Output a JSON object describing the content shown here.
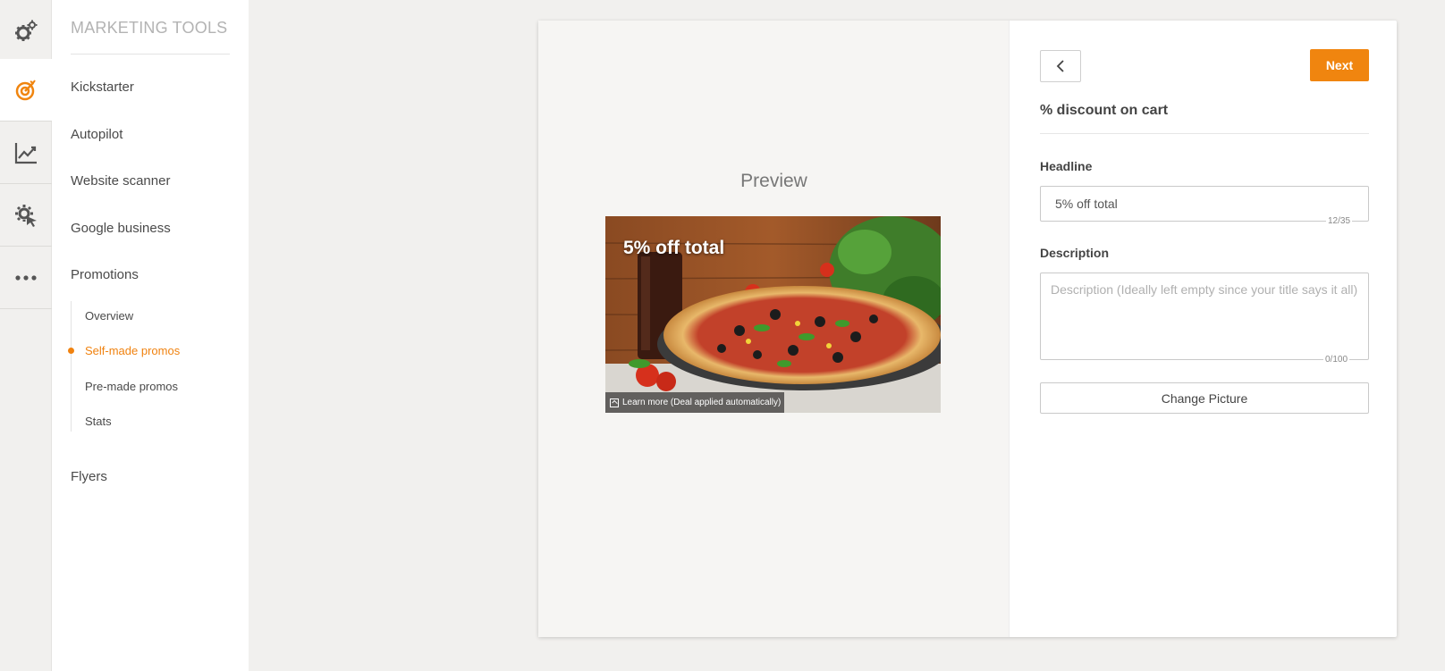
{
  "sidebar": {
    "title": "MARKETING TOOLS",
    "items": [
      {
        "label": "Kickstarter"
      },
      {
        "label": "Autopilot"
      },
      {
        "label": "Website scanner"
      },
      {
        "label": "Google business"
      },
      {
        "label": "Promotions"
      },
      {
        "label": "Flyers"
      }
    ],
    "promotions_sub": [
      {
        "label": "Overview"
      },
      {
        "label": "Self-made promos",
        "active": true
      },
      {
        "label": "Pre-made promos"
      },
      {
        "label": "Stats"
      }
    ]
  },
  "rail": {
    "icons": [
      "settings-gears-icon",
      "target-icon",
      "chart-line-icon",
      "gear-cursor-icon",
      "more-dots-icon"
    ],
    "active": "target-icon"
  },
  "preview": {
    "title": "Preview",
    "headline": "5% off total",
    "learn_more": "Learn more (Deal applied automatically)"
  },
  "form": {
    "back_icon": "chevron-left-icon",
    "next_label": "Next",
    "title": "% discount on cart",
    "headline_label": "Headline",
    "headline_value": "5% off total",
    "headline_counter": "12/35",
    "description_label": "Description",
    "description_placeholder": "Description (Ideally left empty since your title says it all)",
    "description_counter": "0/100",
    "change_picture_label": "Change Picture"
  },
  "colors": {
    "accent": "#f0850f",
    "background": "#f1f0ee"
  }
}
